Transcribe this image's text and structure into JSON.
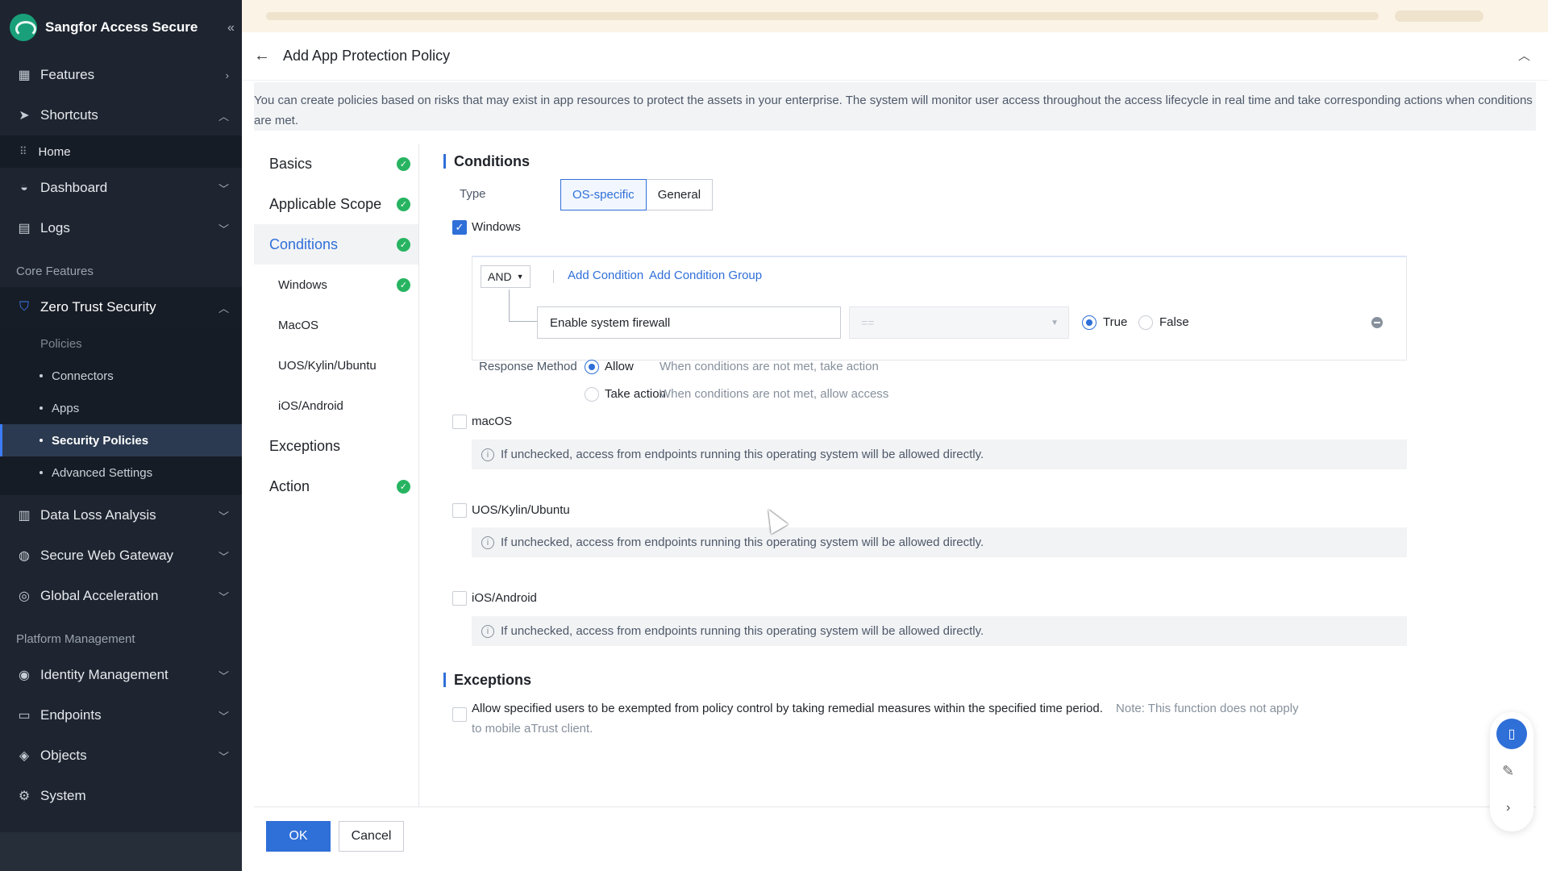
{
  "brand": {
    "name": "Sangfor Access Secure"
  },
  "sidebar": {
    "features": "Features",
    "shortcuts": "Shortcuts",
    "home": "Home",
    "dashboard": "Dashboard",
    "logs": "Logs",
    "core_features": "Core Features",
    "zero_trust": "Zero Trust Security",
    "policies": "Policies",
    "sub": [
      "Connectors",
      "Apps",
      "Security Policies",
      "Advanced Settings"
    ],
    "data_loss": "Data Loss Analysis",
    "swg": "Secure Web Gateway",
    "global_acc": "Global Acceleration",
    "platform_mgmt": "Platform Management",
    "identity": "Identity Management",
    "endpoints": "Endpoints",
    "objects": "Objects",
    "system": "System"
  },
  "page": {
    "title": "Add App Protection Policy",
    "description": "You can create policies based on risks that may exist in app resources to protect the assets in your enterprise. The system will monitor user access throughout the access lifecycle in real time and take corresponding actions when conditions are met."
  },
  "steps": {
    "basics": "Basics",
    "scope": "Applicable Scope",
    "conditions": "Conditions",
    "windows": "Windows",
    "macos": "MacOS",
    "uos": "UOS/Kylin/Ubuntu",
    "ios": "iOS/Android",
    "exceptions": "Exceptions",
    "action": "Action"
  },
  "conditions": {
    "title": "Conditions",
    "type_label": "Type",
    "type_options": [
      "OS-specific",
      "General"
    ],
    "windows_label": "Windows",
    "operator": "AND",
    "add_condition": "Add Condition",
    "add_group": "Add Condition Group",
    "condition_name": "Enable system firewall",
    "comparator": "==",
    "true_label": "True",
    "false_label": "False",
    "response_label": "Response Method",
    "allow_label": "Allow",
    "allow_hint": "When conditions are not met, take action",
    "take_action_label": "Take action",
    "take_action_hint": "When conditions are not met, allow access",
    "macos_label": "macOS",
    "uos_label": "UOS/Kylin/Ubuntu",
    "ios_label": "iOS/Android",
    "unchecked_hint": "If unchecked, access from endpoints running this operating system will be allowed directly."
  },
  "exceptions": {
    "title": "Exceptions",
    "text": "Allow specified users to be exempted from policy control by taking remedial measures within the specified time period.",
    "note": "Note: This function does not apply",
    "note_line2": "to mobile aTrust client."
  },
  "footer": {
    "ok": "OK",
    "cancel": "Cancel"
  },
  "colors": {
    "accent": "#2f6fd8",
    "success": "#27b461",
    "sidebar_bg": "#1e2530"
  }
}
